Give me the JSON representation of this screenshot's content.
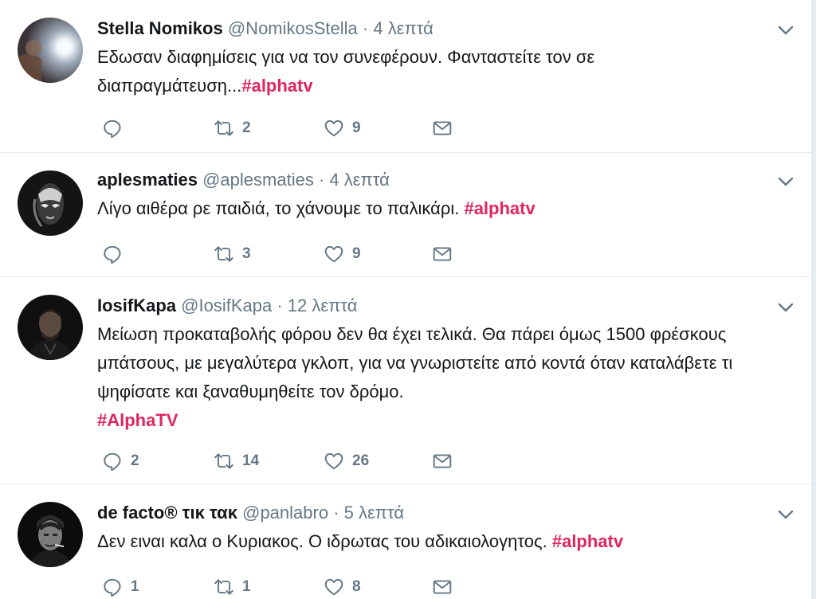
{
  "tweets": [
    {
      "name": "Stella Nomikos",
      "handle": "@NomikosStella",
      "separator": "·",
      "time": "4 λεπτά",
      "text": "Εδωσαν διαφημίσεις για να τον συνεφέρουν. Φανταστείτε τον σε διαπραγμάτευση...",
      "hashtag": "#alphatv",
      "replies": "",
      "retweets": "2",
      "likes": "9"
    },
    {
      "name": "aplesmaties",
      "handle": "@aplesmaties",
      "separator": "·",
      "time": "4 λεπτά",
      "text": "Λίγο αιθέρα ρε παιδιά, το χάνουμε το παλικάρι. ",
      "hashtag": "#alphatv",
      "replies": "",
      "retweets": "3",
      "likes": "9"
    },
    {
      "name": "IosifKapa",
      "handle": "@IosifKapa",
      "separator": "·",
      "time": "12 λεπτά",
      "text": "Μείωση προκαταβολής φόρου δεν θα έχει τελικά. Θα πάρει όμως 1500 φρέσκους μπάτσους, με μεγαλύτερα γκλοπ, για να γνωριστείτε από κοντά όταν καταλάβετε τι ψηφίσατε και ξαναθυμηθείτε τον δρόμο.",
      "hashtag": "#AlphaTV",
      "replies": "2",
      "retweets": "14",
      "likes": "26"
    },
    {
      "name": "de facto® τικ τακ",
      "handle": "@panlabro",
      "separator": "·",
      "time": "5 λεπτά",
      "text": "Δεν ειναι καλα ο Κυριακος. Ο ιδρωτας του αδικαιολογητος. ",
      "hashtag": "#alphatv",
      "replies": "1",
      "retweets": "1",
      "likes": "8"
    }
  ],
  "colors": {
    "hashtag": "#e0245e",
    "meta": "#657786",
    "divider": "#e6ecf0"
  },
  "icons": {
    "reply": "reply-icon",
    "retweet": "retweet-icon",
    "like": "heart-icon",
    "message": "envelope-icon",
    "menu": "chevron-down-icon"
  }
}
